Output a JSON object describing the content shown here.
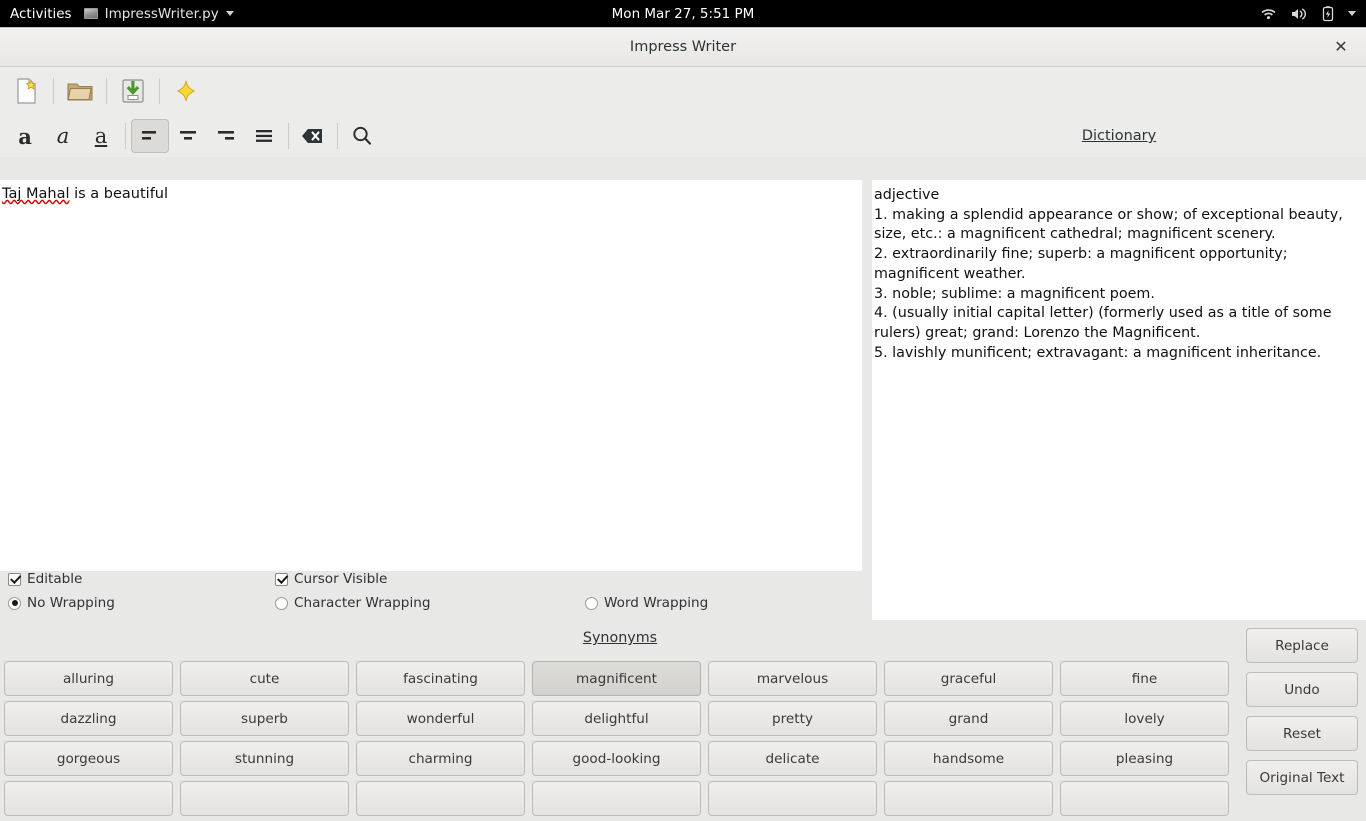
{
  "topbar": {
    "activities": "Activities",
    "app_name": "ImpressWriter.py",
    "clock": "Mon Mar 27,  5:51 PM",
    "icons": [
      "wifi-icon",
      "volume-icon",
      "battery-icon",
      "chevron-down-icon"
    ]
  },
  "window": {
    "title": "Impress Writer",
    "close_label": "✕"
  },
  "toolbar_file": [
    {
      "name": "new-document-button",
      "icon": "new-document-icon"
    },
    {
      "name": "open-folder-button",
      "icon": "open-folder-icon"
    },
    {
      "name": "save-button",
      "icon": "save-icon"
    },
    {
      "name": "magic-button",
      "icon": "sparkle-icon"
    }
  ],
  "toolbar_format": [
    {
      "name": "bold-button",
      "icon": "bold-icon",
      "glyph": "a",
      "active": false
    },
    {
      "name": "italic-button",
      "icon": "italic-icon",
      "glyph": "a",
      "active": false
    },
    {
      "name": "underline-button",
      "icon": "underline-icon",
      "glyph": "a",
      "active": false
    },
    {
      "name": "align-left-button",
      "icon": "align-left-icon",
      "active": true
    },
    {
      "name": "align-center-button",
      "icon": "align-center-icon",
      "active": false
    },
    {
      "name": "align-right-button",
      "icon": "align-right-icon",
      "active": false
    },
    {
      "name": "align-justify-button",
      "icon": "align-justify-icon",
      "active": false
    },
    {
      "name": "clear-formatting-button",
      "icon": "backspace-icon",
      "active": false
    },
    {
      "name": "search-button",
      "icon": "search-icon",
      "active": false
    }
  ],
  "editor": {
    "text_misspelled": "Taj Mahal",
    "text_rest": " is a beautiful"
  },
  "dictionary": {
    "heading": "Dictionary",
    "part_of_speech": "adjective",
    "definitions": [
      " 1. making a splendid appearance or show; of exceptional beauty, size, etc.: a magnificent cathedral; magnificent scenery.",
      " 2. extraordinarily fine; superb: a magnificent opportunity; magnificent weather.",
      " 3. noble; sublime: a magnificent poem.",
      " 4. (usually initial capital letter) (formerly used as a title of some rulers) great; grand: Lorenzo the Magnificent.",
      " 5. lavishly munificent; extravagant: a magnificent inheritance."
    ]
  },
  "options": {
    "editable": {
      "label": "Editable",
      "checked": true
    },
    "cursor_visible": {
      "label": "Cursor Visible",
      "checked": true
    },
    "wrapping": {
      "selected": "No Wrapping",
      "choices": [
        "No Wrapping",
        "Character Wrapping",
        "Word Wrapping"
      ]
    }
  },
  "synonyms": {
    "heading": "Synonyms",
    "selected": "magnificent",
    "rows": [
      [
        "alluring",
        "cute",
        "fascinating",
        "magnificent",
        "marvelous",
        "graceful",
        "fine"
      ],
      [
        "dazzling",
        "superb",
        "wonderful",
        "delightful",
        "pretty",
        "grand",
        "lovely"
      ],
      [
        "gorgeous",
        "stunning",
        "charming",
        "good-looking",
        "delicate",
        "handsome",
        "pleasing"
      ],
      [
        "",
        "",
        "",
        "",
        "",
        "",
        ""
      ]
    ]
  },
  "actions": [
    {
      "name": "replace-button",
      "label": "Replace"
    },
    {
      "name": "undo-button",
      "label": "Undo"
    },
    {
      "name": "reset-button",
      "label": "Reset"
    },
    {
      "name": "original-text-button",
      "label": "Original Text"
    }
  ],
  "colors": {
    "window_bg": "#e8e8e6",
    "toolbar_bg": "#ececeb",
    "panel_bg": "#ffffff",
    "text": "#2e3436",
    "spellcheck": "#d40000",
    "selected_button": "#dedcd9"
  }
}
